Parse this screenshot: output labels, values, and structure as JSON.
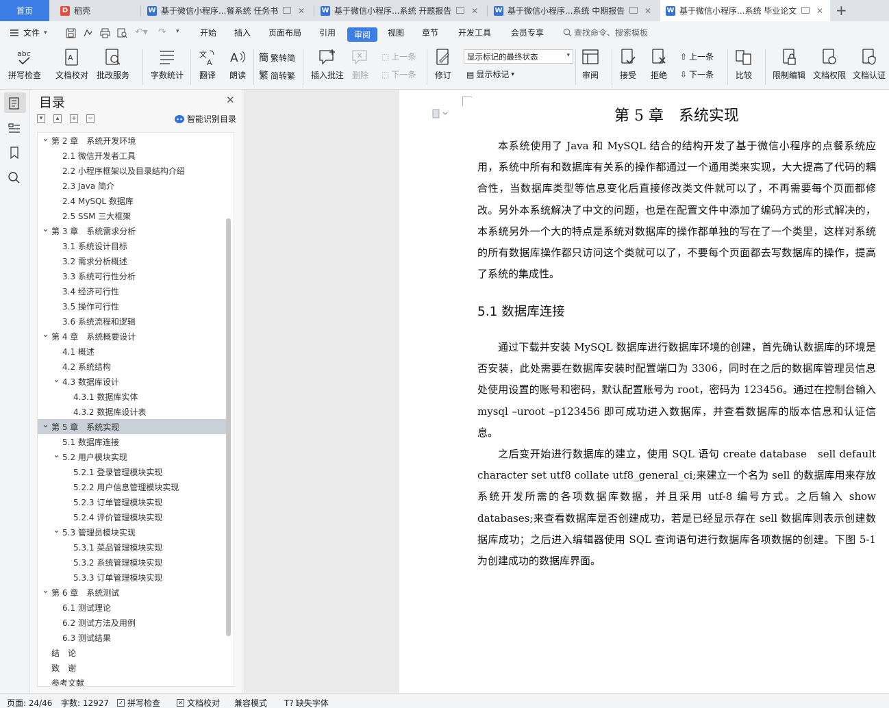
{
  "tabs": {
    "home": "首页",
    "daoke": "稻壳",
    "doc1": "基于微信小程序...餐系统 任务书",
    "doc2": "基于微信小程序...系统 开题报告",
    "doc3": "基于微信小程序...系统 中期报告",
    "doc4": "基于微信小程序...系统 毕业论文"
  },
  "menu": {
    "file": "文件",
    "items": [
      "开始",
      "插入",
      "页面布局",
      "引用",
      "审阅",
      "视图",
      "章节",
      "开发工具",
      "会员专享"
    ],
    "search": "查找命令、搜索模板"
  },
  "toolbar": {
    "spell": "拼写检查",
    "doc_check": "文档校对",
    "batch": "批改服务",
    "word_count": "字数统计",
    "translate": "翻译",
    "read": "朗读",
    "to_trad": "繁转简",
    "to_simp": "简转繁",
    "insert_comment": "插入批注",
    "delete": "删除",
    "prev": "上一条",
    "next": "下一条",
    "revise": "修订",
    "markup_select": "显示标记的最终状态",
    "show_markup": "显示标记",
    "review": "审阅",
    "accept": "接受",
    "reject": "拒绝",
    "prev2": "上一条",
    "next2": "下一条",
    "compare": "比较",
    "restrict": "限制编辑",
    "doc_rights": "文档权限",
    "doc_cert": "文档认证"
  },
  "toc": {
    "title": "目录",
    "smart": "智能识别目录",
    "items": [
      {
        "text": "第 2 章　系统开发环境",
        "level": 1
      },
      {
        "text": "2.1 微信开发者工具",
        "level": 2
      },
      {
        "text": "2.2 小程序框架以及目录结构介绍",
        "level": 2
      },
      {
        "text": "2.3 Java 简介",
        "level": 2
      },
      {
        "text": "2.4 MySQL 数据库",
        "level": 2
      },
      {
        "text": "2.5 SSM 三大框架",
        "level": 2
      },
      {
        "text": "第 3 章　系统需求分析",
        "level": 1
      },
      {
        "text": "3.1  系统设计目标",
        "level": 2
      },
      {
        "text": "3.2 需求分析概述",
        "level": 2
      },
      {
        "text": "3.3  系统可行性分析",
        "level": 2
      },
      {
        "text": "3.4 经济可行性",
        "level": 2
      },
      {
        "text": "3.5 操作可行性",
        "level": 2
      },
      {
        "text": "3.6 系统流程和逻辑",
        "level": 2
      },
      {
        "text": "第 4 章　系统概要设计",
        "level": 1
      },
      {
        "text": "4.1  概述",
        "level": 2
      },
      {
        "text": "4.2  系统结构",
        "level": 2
      },
      {
        "text": "4.3  数据库设计",
        "level": 2
      },
      {
        "text": "4.3.1  数据库实体",
        "level": 3
      },
      {
        "text": "4.3.2  数据库设计表",
        "level": 3
      },
      {
        "text": "第 5 章　系统实现",
        "level": 1
      },
      {
        "text": "5.1 数据库连接",
        "level": 2
      },
      {
        "text": "5.2 用户模块实现",
        "level": 2
      },
      {
        "text": "5.2.1  登录管理模块实现",
        "level": 3
      },
      {
        "text": "5.2.2  用户信息管理模块实现",
        "level": 3
      },
      {
        "text": "5.2.3  订单管理模块实现",
        "level": 3
      },
      {
        "text": "5.2.4  评价管理模块实现",
        "level": 3
      },
      {
        "text": "5.3  管理员模块实现",
        "level": 2
      },
      {
        "text": "5.3.1  菜品管理模块实现",
        "level": 3
      },
      {
        "text": "5.3.2  系统管理模块实现",
        "level": 3
      },
      {
        "text": "5.3.3  订单管理模块实现",
        "level": 3
      },
      {
        "text": "第 6 章　系统测试",
        "level": 1
      },
      {
        "text": "6.1  测试理论",
        "level": 2
      },
      {
        "text": "6.2  测试方法及用例",
        "level": 2
      },
      {
        "text": "6.3 测试结果",
        "level": 2
      },
      {
        "text": "结　论",
        "level": 1
      },
      {
        "text": "致　谢",
        "level": 1
      },
      {
        "text": "参考文献",
        "level": 1
      }
    ]
  },
  "doc": {
    "chapter": "第 5 章　系统实现",
    "p1": "本系统使用了 Java 和 MySQL 结合的结构开发了基于微信小程序的点餐系统应用，系统中所有和数据库有关系的操作都通过一个通用类来实现，大大提高了代码的耦合性，当数据库类型等信息变化后直接修改类文件就可以了，不再需要每个页面都修改。另外本系统解决了中文的问题，也是在配置文件中添加了编码方式的形式解决的，本系统另外一个大的特点是系统对数据库的操作都单独的写在了一个类里，这样对系统的所有数据库操作都只访问这个类就可以了，不要每个页面都去写数据库的操作，提高了系统的集成性。",
    "h51": "5.1 数据库连接",
    "p2": "通过下载并安装 MySQL 数据库进行数据库环境的创建，首先确认数据库的环境是否安装，此处需要在数据库安装时配置端口为 3306，同时在之后的数据库管理员信息处使用设置的账号和密码，默认配置账号为 root，密码为 123456。通过在控制台输入 mysql –uroot –p123456 即可成功进入数据库，并查看数据库的版本信息和认证信息。",
    "p3": "之后变开始进行数据库的建立，使用 SQL 语句 create database　sell default character set utf8 collate utf8_general_ci;来建立一个名为 sell 的数据库用来存放系统开发所需的各项数据库数据，并且采用 utf-8 编号方式。之后输入 show databases;来查看数据库是否创建成功，若是已经显示存在 sell 数据库则表示创建数据库成功；之后进入编辑器使用 SQL 查询语句进行数据库各项数据的创建。下图 5-1 为创建成功的数据库界面。"
  },
  "status": {
    "page": "页面: 24/46",
    "words": "字数: 12927",
    "spell": "拼写检查",
    "doccheck": "文档校对",
    "compat": "兼容模式",
    "missing_font": "缺失字体"
  }
}
